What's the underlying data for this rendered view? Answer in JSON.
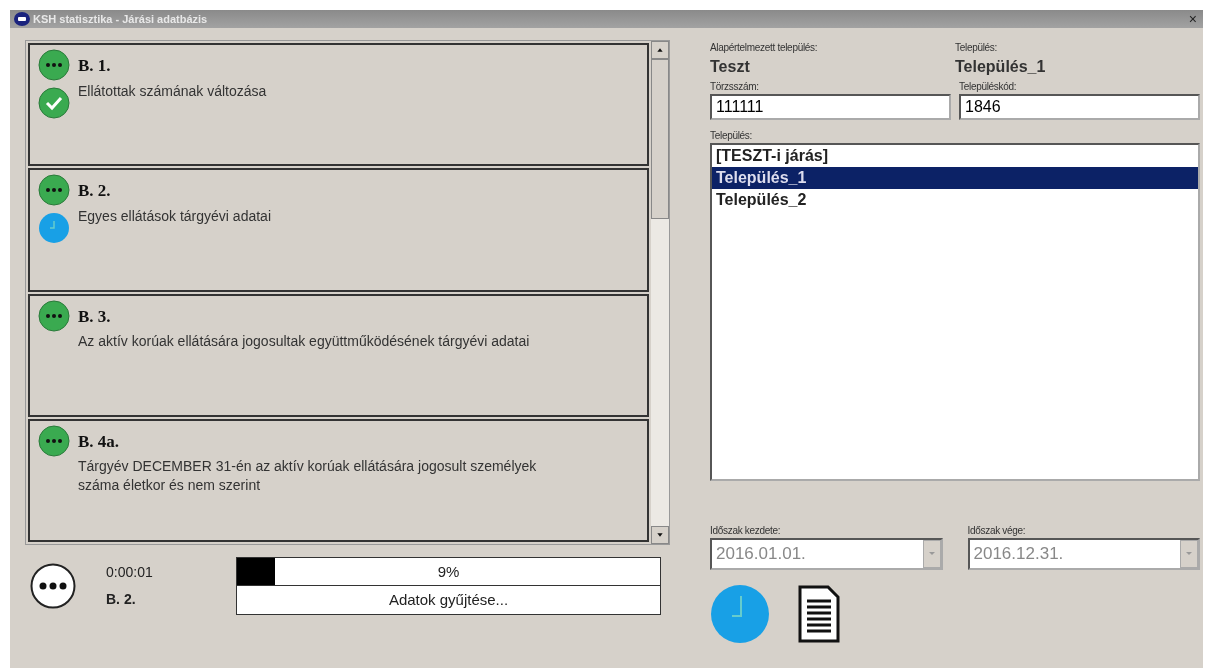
{
  "window": {
    "title": "KSH statisztika - Járási adatbázis",
    "close": "×"
  },
  "tasks": [
    {
      "code": "B. 1.",
      "description": "Ellátottak számának változása",
      "kind": "done"
    },
    {
      "code": "B. 2.",
      "description": "Egyes ellátások tárgyévi adatai",
      "kind": "running"
    },
    {
      "code": "B. 3.",
      "description": "Az aktív korúak ellátására jogosultak együttműködésének tárgyévi adatai",
      "kind": "pending"
    },
    {
      "code": "B. 4a.",
      "description": "Tárgyév DECEMBER 31-én az aktív korúak ellátására jogosult személyek száma életkor és nem szerint",
      "kind": "pending"
    }
  ],
  "progress": {
    "elapsed": "0:00:01",
    "current": "B. 2.",
    "level": 0.09,
    "reading": "9%",
    "message": "Adatok gyűjtése..."
  },
  "info": {
    "default_label": "Alapértelmezett település:",
    "default_value": "Teszt",
    "settlement_label": "Település:",
    "settlement_value": "Település_1"
  },
  "fields": [
    {
      "label": "Törzsszám:",
      "value": "111111"
    },
    {
      "label": "Településkód:",
      "value": "1846"
    }
  ],
  "settlement_list": {
    "label": "Település:",
    "items": [
      {
        "text": "[TESZT-i járás]",
        "selected": false
      },
      {
        "text": "Település_1",
        "selected": true
      },
      {
        "text": "Település_2",
        "selected": false
      }
    ]
  },
  "period": [
    {
      "label": "Időszak kezdete:",
      "value": "2016.01.01.",
      "disabled": true
    },
    {
      "label": "Időszak vége:",
      "value": "2016.12.31.",
      "disabled": true
    }
  ]
}
